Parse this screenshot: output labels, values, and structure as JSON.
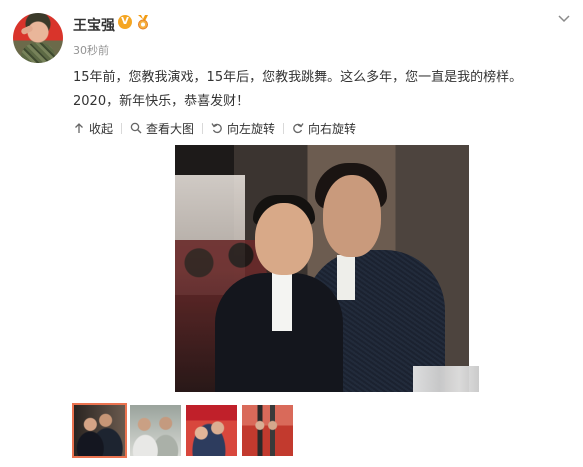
{
  "post": {
    "username": "王宝强",
    "verified_badge": "V",
    "timestamp": "30秒前",
    "text_line1": "15年前，您教我演戏，15年后，您教我跳舞。这么多年，您一直是我的榜样。",
    "text_line2": "2020，新年快乐，恭喜发财！"
  },
  "toolbar": {
    "collapse_label": "收起",
    "view_large_label": "查看大图",
    "rotate_left_label": "向左旋转",
    "rotate_right_label": "向右旋转"
  },
  "thumbnails": {
    "count": 4,
    "selected_index": 0
  },
  "colors": {
    "accent_selected": "#eb7350",
    "verified_badge": "#f5a623",
    "timestamp_gray": "#939393",
    "text_dark": "#333333"
  }
}
